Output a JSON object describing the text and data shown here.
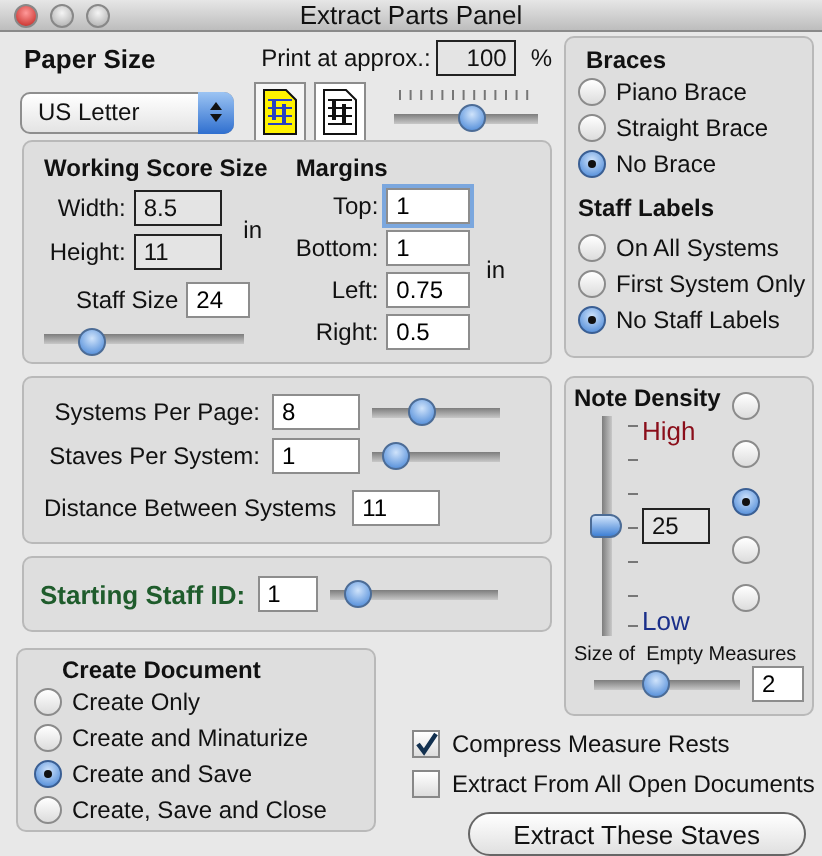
{
  "window": {
    "title": "Extract Parts Panel"
  },
  "paper_size": {
    "label": "Paper Size",
    "value": "US Letter"
  },
  "print_scale": {
    "label": "Print at approx.:",
    "value": "100",
    "unit": "%",
    "level": 0.55
  },
  "page_view_buttons": [
    {
      "selected": true
    },
    {
      "selected": false
    }
  ],
  "working_score_size": {
    "title": "Working Score Size",
    "fields": [
      {
        "label": "Width:",
        "value": "8.5"
      },
      {
        "label": "Height:",
        "value": "11"
      }
    ],
    "unit": "in",
    "staff_size": {
      "label": "Staff Size",
      "value": "24",
      "level": 0.2
    }
  },
  "margins": {
    "title": "Margins",
    "unit": "in",
    "fields": [
      {
        "label": "Top:",
        "value": "1",
        "focused": true
      },
      {
        "label": "Bottom:",
        "value": "1",
        "focused": false
      },
      {
        "label": "Left:",
        "value": "0.75",
        "focused": false
      },
      {
        "label": "Right:",
        "value": "0.5",
        "focused": false
      }
    ]
  },
  "systems": {
    "rows": [
      {
        "label": "Systems Per Page:",
        "value": "8",
        "level": 0.35
      },
      {
        "label": "Staves Per System:",
        "value": "1",
        "level": 0.1
      }
    ],
    "distance": {
      "label": "Distance Between Systems",
      "value": "11"
    }
  },
  "starting_staff_id": {
    "label": "Starting Staff ID:",
    "value": "1",
    "level": 0.1
  },
  "braces": {
    "title": "Braces",
    "options": [
      {
        "label": "Piano Brace",
        "selected": false
      },
      {
        "label": "Straight Brace",
        "selected": false
      },
      {
        "label": "No Brace",
        "selected": true
      }
    ]
  },
  "staff_labels": {
    "title": "Staff Labels",
    "options": [
      {
        "label": "On All Systems",
        "selected": false
      },
      {
        "label": "First System Only",
        "selected": false
      },
      {
        "label": "No Staff Labels",
        "selected": true
      }
    ]
  },
  "note_density": {
    "title": "Note Density",
    "high": "High",
    "low": "Low",
    "value": "25",
    "level": 0.5,
    "options": [
      {
        "selected": false
      },
      {
        "selected": false
      },
      {
        "selected": true
      },
      {
        "selected": false
      },
      {
        "selected": false
      }
    ]
  },
  "empty_measures": {
    "label": "Size of  Empty Measures",
    "value": "2",
    "level": 0.4
  },
  "create_document": {
    "title": "Create Document",
    "options": [
      {
        "label": "Create Only",
        "selected": false
      },
      {
        "label": "Create and Minaturize",
        "selected": false
      },
      {
        "label": "Create and Save",
        "selected": true
      },
      {
        "label": "Create, Save and Close",
        "selected": false
      }
    ]
  },
  "checkboxes": [
    {
      "label": "Compress Measure Rests",
      "checked": true
    },
    {
      "label": "Extract From All Open Documents",
      "checked": false
    }
  ],
  "button": {
    "label": "Extract These Staves"
  }
}
